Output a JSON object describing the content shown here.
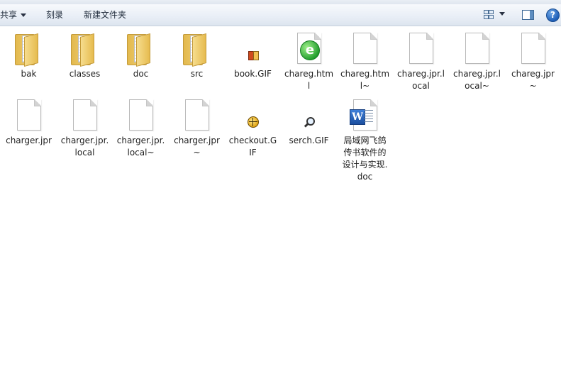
{
  "toolbar": {
    "share_label": "共享",
    "burn_label": "刻录",
    "new_folder_label": "新建文件夹",
    "help_label": "?"
  },
  "files": [
    {
      "name": "bak",
      "type": "folder"
    },
    {
      "name": "classes",
      "type": "folder"
    },
    {
      "name": "doc",
      "type": "folder"
    },
    {
      "name": "src",
      "type": "folder"
    },
    {
      "name": "book.GIF",
      "type": "gif-book"
    },
    {
      "name": "chareg.html",
      "type": "html"
    },
    {
      "name": "chareg.html~",
      "type": "file"
    },
    {
      "name": "chareg.jpr.local",
      "type": "file"
    },
    {
      "name": "chareg.jpr.local~",
      "type": "file"
    },
    {
      "name": "chareg.jpr~",
      "type": "file"
    },
    {
      "name": "charger.jpr",
      "type": "file"
    },
    {
      "name": "charger.jpr.local",
      "type": "file"
    },
    {
      "name": "charger.jpr.local~",
      "type": "file"
    },
    {
      "name": "charger.jpr~",
      "type": "file"
    },
    {
      "name": "checkout.GIF",
      "type": "gif-ball"
    },
    {
      "name": "serch.GIF",
      "type": "gif-search"
    },
    {
      "name": "局域网飞鸽传书软件的设计与实现.doc",
      "type": "word"
    }
  ]
}
